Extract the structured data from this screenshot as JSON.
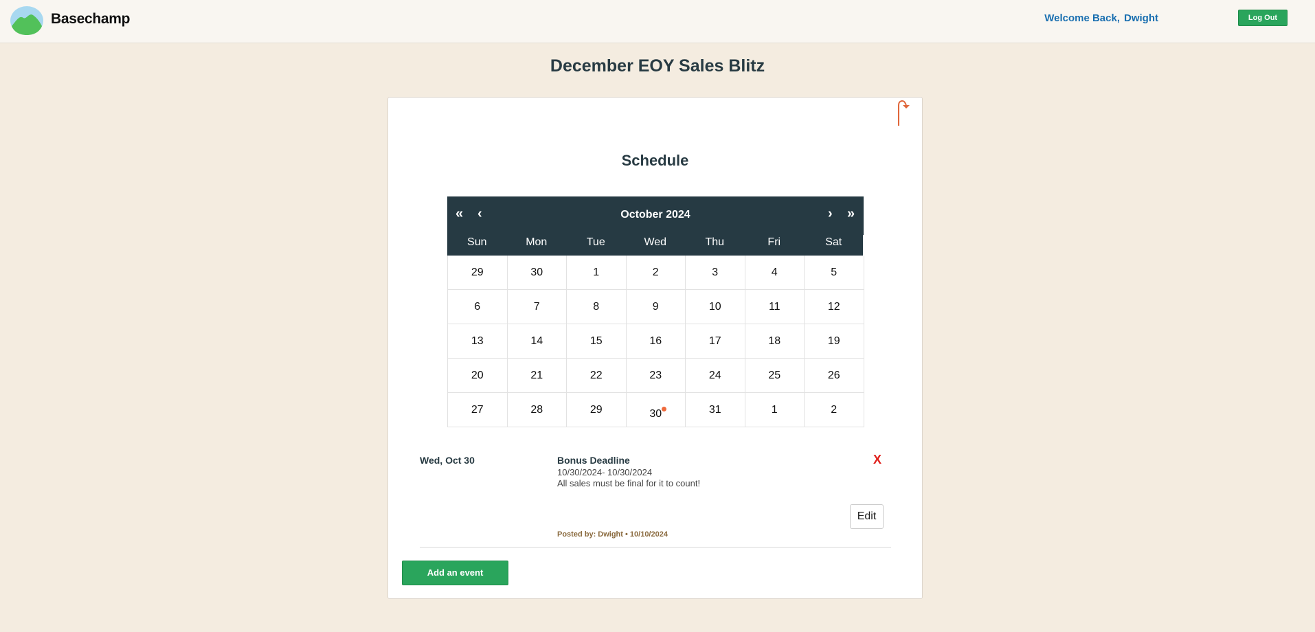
{
  "header": {
    "brand": "Basechamp",
    "welcome_text": "Welcome Back,",
    "username": "Dwight",
    "logout_label": "Log Out"
  },
  "project": {
    "title": "December EOY Sales Blitz"
  },
  "schedule": {
    "title": "Schedule",
    "calendar": {
      "month_label": "October 2024",
      "nav": {
        "prev_year": "«",
        "prev_month": "‹",
        "next_month": "›",
        "next_year": "»"
      },
      "weekdays": [
        "Sun",
        "Mon",
        "Tue",
        "Wed",
        "Thu",
        "Fri",
        "Sat"
      ],
      "weeks": [
        [
          "29",
          "30",
          "1",
          "2",
          "3",
          "4",
          "5"
        ],
        [
          "6",
          "7",
          "8",
          "9",
          "10",
          "11",
          "12"
        ],
        [
          "13",
          "14",
          "15",
          "16",
          "17",
          "18",
          "19"
        ],
        [
          "20",
          "21",
          "22",
          "23",
          "24",
          "25",
          "26"
        ],
        [
          "27",
          "28",
          "29",
          "30",
          "31",
          "1",
          "2"
        ]
      ],
      "event_days": [
        "30"
      ]
    },
    "event": {
      "date_label": "Wed, Oct 30",
      "title": "Bonus Deadline",
      "range": "10/30/2024- 10/30/2024",
      "description": "All sales must be final for it to count!",
      "delete_label": "X",
      "edit_label": "Edit",
      "posted_by": "Posted by: Dwight • 10/10/2024"
    },
    "add_event_label": "Add an event"
  },
  "colors": {
    "accent_green": "#2aa55c",
    "calendar_header": "#263a43",
    "event_dot": "#ef6a3c",
    "delete_red": "#e0201c",
    "link_blue": "#1a6fb0"
  },
  "icons": {
    "logo": "basecamp-mountain-logo",
    "bookmark": "bookmark-arrow-icon",
    "event_marker": "event-dot-icon"
  }
}
